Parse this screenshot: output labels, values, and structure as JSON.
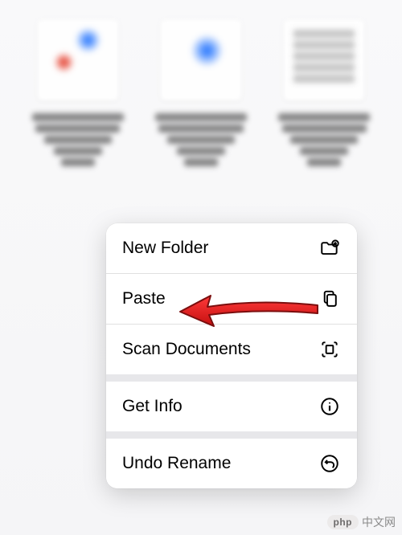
{
  "menu": {
    "items": [
      {
        "label": "New Folder",
        "icon": "folder-plus-icon"
      },
      {
        "label": "Paste",
        "icon": "paste-icon"
      },
      {
        "label": "Scan Documents",
        "icon": "scan-icon"
      },
      {
        "label": "Get Info",
        "icon": "info-icon"
      },
      {
        "label": "Undo Rename",
        "icon": "undo-icon"
      }
    ]
  },
  "arrow": {
    "color": "#e11d1d",
    "stroke": "#7b0e0e"
  },
  "watermark": {
    "pill": "php",
    "text": "中文网"
  }
}
